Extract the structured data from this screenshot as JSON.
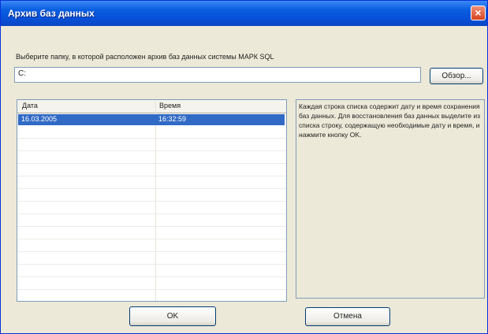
{
  "window": {
    "title": "Архив баз данных",
    "close_label": "×"
  },
  "prompt": "Выберите папку, в которой расположен архив баз данных системы МАРК SQL",
  "path_value": "C:",
  "browse_label": "Обзор...",
  "table": {
    "columns": [
      "Дата",
      "Время"
    ],
    "rows": [
      {
        "date": "16.03.2005",
        "time": "16:32:59",
        "selected": true
      }
    ]
  },
  "info_text": "Каждая строка списка содержит дату и время сохранения баз данных. Для восстановления баз данных выделите из списка строку, содержащую необходимые дату и время, и нажмите кнопку OK.",
  "buttons": {
    "ok": "OK",
    "cancel": "Отмена"
  },
  "colors": {
    "titlebar": "#0a5fe0",
    "selection": "#316ac5",
    "dialog_bg": "#ece9d8"
  }
}
